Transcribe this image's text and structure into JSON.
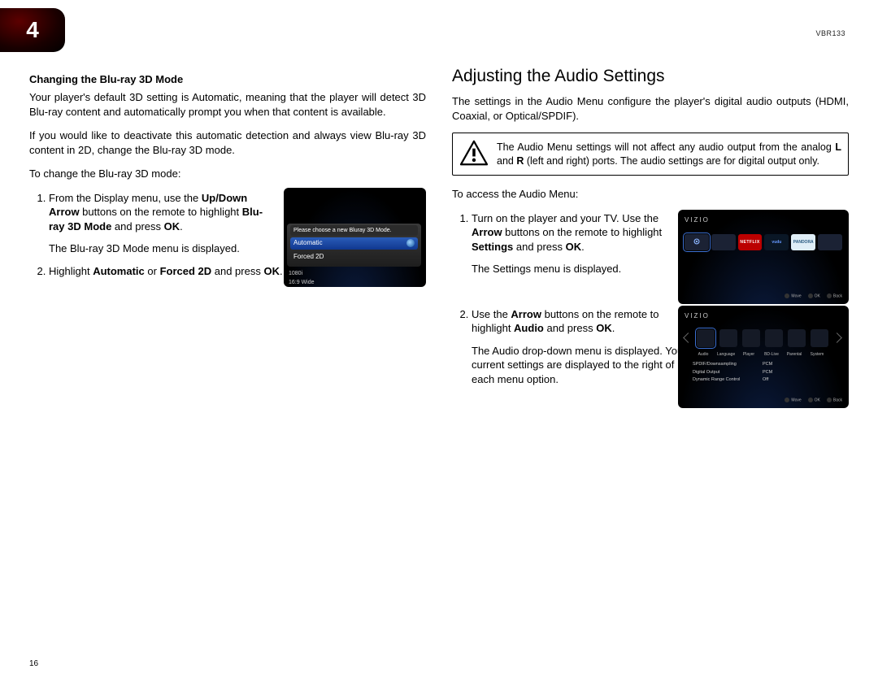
{
  "meta": {
    "chapter_number": "4",
    "model": "VBR133",
    "page_number": "16"
  },
  "left": {
    "subheading": "Changing the Blu-ray 3D Mode",
    "intro_p1": "Your player's default 3D setting is Automatic, meaning that the player will detect 3D Blu-ray content and automatically prompt you when that content is available.",
    "intro_p2": "If you would like to deactivate this automatic detection and always view Blu-ray 3D content in 2D, change the Blu-ray 3D mode.",
    "lead": "To change the Blu-ray 3D mode:",
    "step1": {
      "a": "From the Display menu, use the ",
      "b_bold": "Up/Down Arrow",
      "c": " buttons on the remote to highlight ",
      "d_bold": "Blu-ray 3D Mode",
      "e": " and press ",
      "f_bold": "OK",
      "g": ".",
      "after": "The Blu-ray 3D Mode menu is displayed."
    },
    "step2": {
      "a": "Highlight ",
      "b_bold": "Automatic",
      "c": " or ",
      "d_bold": "Forced 2D",
      "e": " and press ",
      "f_bold": "OK",
      "g": "."
    },
    "fig1": {
      "title": "Please choose a new Bluray 3D Mode.",
      "opt1": "Automatic",
      "opt2": "Forced 2D",
      "sub1": "1080i",
      "sub2": "16:9 Wide"
    }
  },
  "right": {
    "section_title": "Adjusting the Audio Settings",
    "intro": "The settings in the Audio Menu configure the player's digital audio outputs (HDMI, Coaxial, or Optical/SPDIF).",
    "callout": {
      "a": "The Audio Menu settings will not affect any audio output from the analog ",
      "b_bold": "L",
      "c": " and ",
      "d_bold": "R",
      "e": " (left and right) ports. The audio settings are for digital output only."
    },
    "lead": "To access the Audio Menu:",
    "step1": {
      "a": "Turn on the player and your TV. Use the ",
      "b_bold": "Arrow",
      "c": " buttons on the remote to highlight ",
      "d_bold": "Settings",
      "e": " and press ",
      "f_bold": "OK",
      "g": ".",
      "after": "The Settings menu is displayed."
    },
    "step2": {
      "a": "Use the ",
      "b_bold": "Arrow",
      "c": " buttons on the remote to highlight ",
      "d_bold": "Audio",
      "e": " and press ",
      "f_bold": "OK",
      "g": ".",
      "after": "The Audio drop-down menu is displayed. Your current settings are displayed to the right of each menu option."
    },
    "fig_brand": "VIZIO",
    "fig2": {
      "tiles": {
        "settings": "",
        "netflix": "NETFLIX",
        "vudu": "vudu",
        "pandora": "PANDORA",
        "more": ""
      },
      "hints": {
        "a": "Move",
        "b": "OK",
        "c": "Back"
      }
    },
    "fig3": {
      "icon_labels": {
        "a": "Audio",
        "b": "Language",
        "c": "Player",
        "d": "BD-Live",
        "e": "Parental",
        "f": "System"
      },
      "rows": {
        "r1k": "SPDIF/Downsampling",
        "r1v": "PCM",
        "r2k": "Digital Output",
        "r2v": "PCM",
        "r3k": "Dynamic Range Control",
        "r3v": "Off"
      },
      "hints": {
        "a": "Move",
        "b": "OK",
        "c": "Back"
      }
    }
  }
}
